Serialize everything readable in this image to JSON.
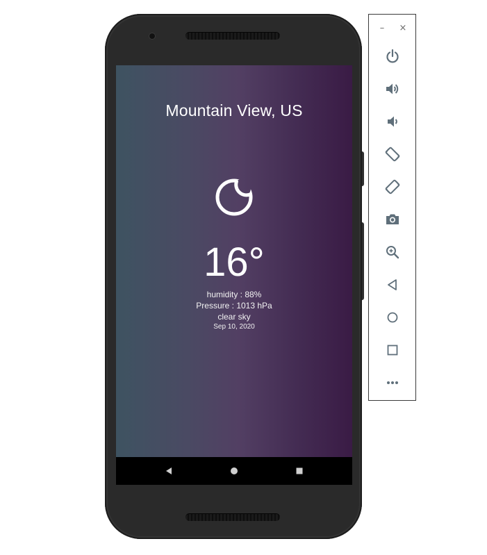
{
  "window": {
    "minimize_glyph": "–",
    "close_glyph": "×"
  },
  "weather": {
    "city": "Mountain View, US",
    "icon": "crescent-moon-icon",
    "temperature": "16°",
    "humidity": "humidity : 88%",
    "pressure": "Pressure : 1013 hPa",
    "description": "clear sky",
    "date": "Sep 10, 2020"
  },
  "android_nav": {
    "items": [
      "back-icon",
      "home-icon",
      "recents-icon"
    ]
  },
  "emulator_toolbar": {
    "tools": [
      "power-icon",
      "volume-up-icon",
      "volume-down-icon",
      "rotate-left-icon",
      "rotate-right-icon",
      "camera-icon",
      "zoom-icon",
      "back-icon",
      "home-icon",
      "overview-icon",
      "more-icon"
    ]
  },
  "colors": {
    "gradient_left": "#3e5361",
    "gradient_mid": "#523f63",
    "gradient_right": "#3a1b45",
    "phone_body": "#2a2a2a",
    "toolbar_icon": "#5f6f7a"
  }
}
